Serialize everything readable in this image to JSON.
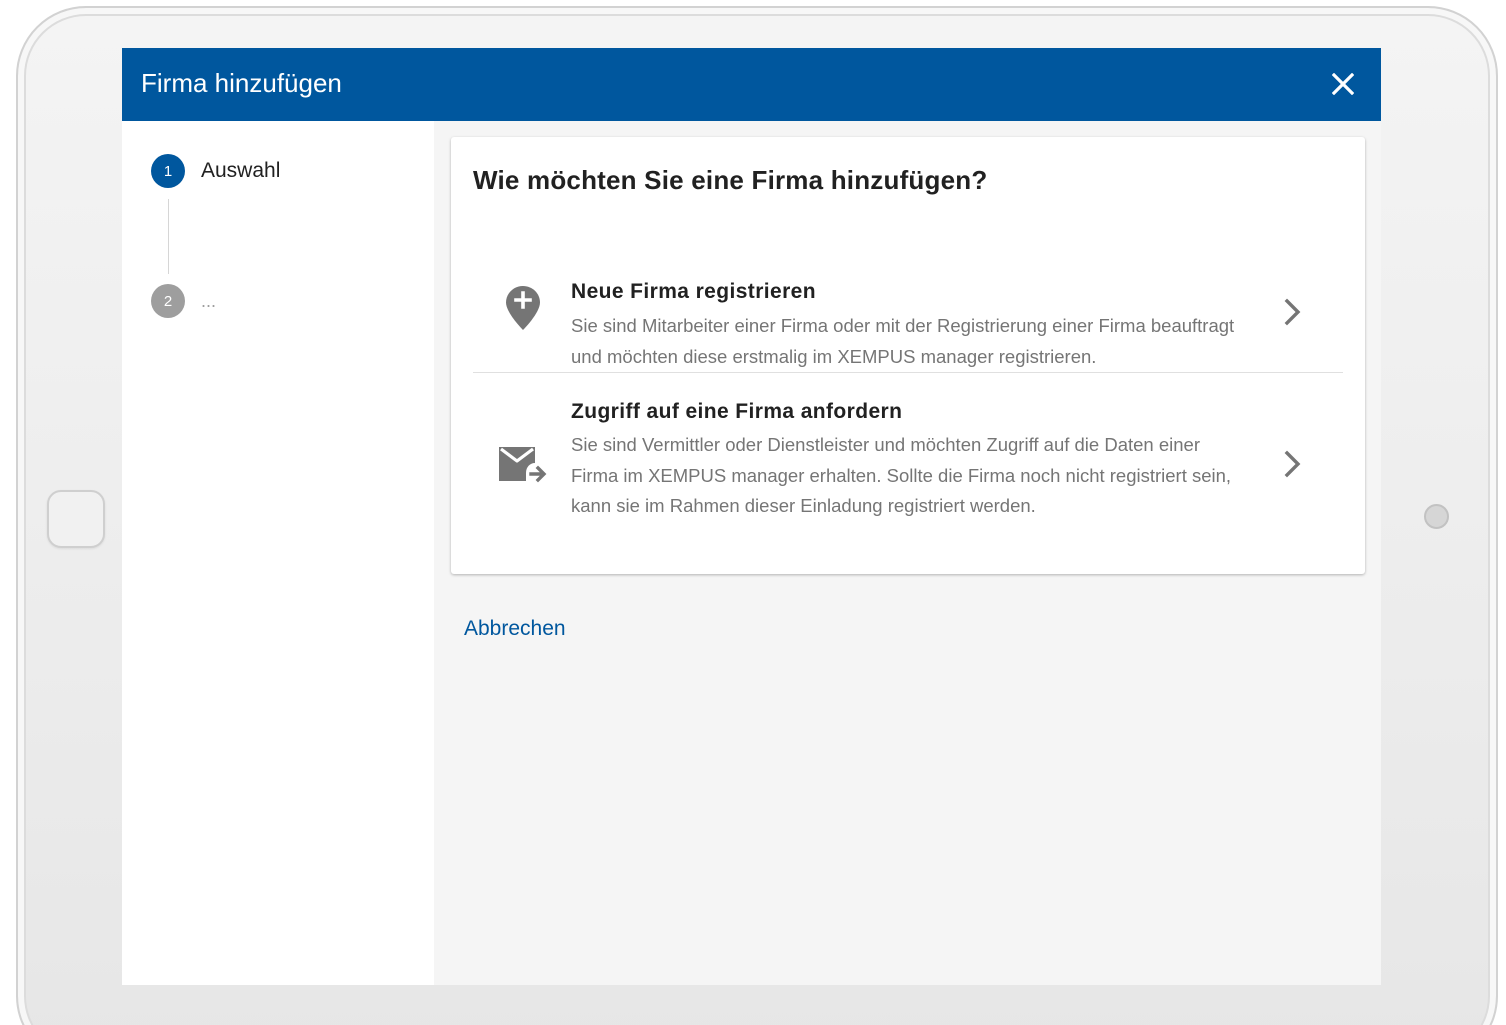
{
  "dialog": {
    "title": "Firma hinzufügen",
    "close_icon": "close-icon"
  },
  "stepper": {
    "steps": [
      {
        "number": "1",
        "label": "Auswahl",
        "state": "active"
      },
      {
        "number": "2",
        "label": "...",
        "state": "inactive"
      }
    ]
  },
  "card": {
    "title": "Wie möchten Sie eine Firma hinzufügen?",
    "options": [
      {
        "icon": "map-pin-plus-icon",
        "title": "Neue Firma registrieren",
        "description": "Sie sind Mitarbeiter einer Firma oder mit der Registrierung einer Firma beauftragt und möchten diese erstmalig im XEMPUS manager registrieren.",
        "chevron_icon": "chevron-right-icon"
      },
      {
        "icon": "mail-forward-icon",
        "title": "Zugriff auf eine Firma anfordern",
        "description": "Sie sind Vermittler oder Dienstleister und möchten Zugriff auf die Daten einer Firma im XEMPUS manager erhalten. Sollte die Firma noch nicht registriert sein, kann sie im Rahmen dieser Einladung registriert werden.",
        "chevron_icon": "chevron-right-icon"
      }
    ]
  },
  "actions": {
    "cancel_label": "Abbrechen"
  },
  "colors": {
    "primary": "#00579e",
    "inactive_step": "#9e9e9e",
    "description_text": "#757575",
    "icon_gray": "#757575",
    "background": "#f5f5f5"
  }
}
